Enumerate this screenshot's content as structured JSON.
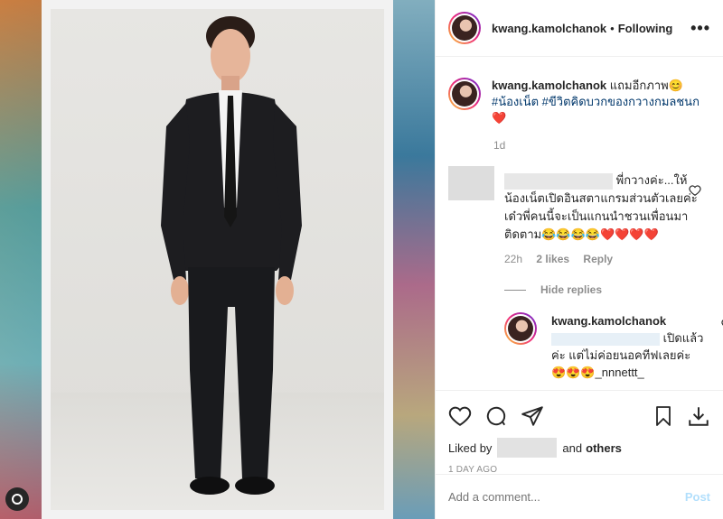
{
  "header": {
    "username": "kwang.kamolchanok",
    "separator": "•",
    "follow_state": "Following",
    "more_icon": "more-horizontal-icon",
    "more_label": "•••"
  },
  "caption": {
    "username": "kwang.kamolchanok",
    "text": "แถมอีกภาพ😊",
    "hashtag1": "#น้องเน็ต",
    "hashtag2": "#ขีวิตคิดบวกของกวางกมลชนก",
    "emoji": "❤️",
    "time": "1d"
  },
  "comment": {
    "text_start": "พี่กวางค่ะ...ให้",
    "text_rest": "น้องเน็ตเปิดอินสตาแกรมส่วนตัวเลยค่ะ เด๋วพี่คนนี้จะเป็นแกนนำชวนเพื่อนมาติดตาม😂😂😂😂❤️❤️❤️❤️",
    "time": "22h",
    "likes": "2 likes",
    "reply_label": "Reply",
    "hide_replies": "Hide replies"
  },
  "reply": {
    "username": "kwang.kamolchanok",
    "text": "เปิดแล้วค่ะ แต่ไม่ค่อยนอคทีฟเลยค่ะ😍😍😍_nnnettt_"
  },
  "actions": {
    "liked_by": "Liked by",
    "and": "and",
    "others": "others",
    "ago": "1 DAY AGO"
  },
  "comment_box": {
    "placeholder": "Add a comment...",
    "post_label": "Post"
  }
}
